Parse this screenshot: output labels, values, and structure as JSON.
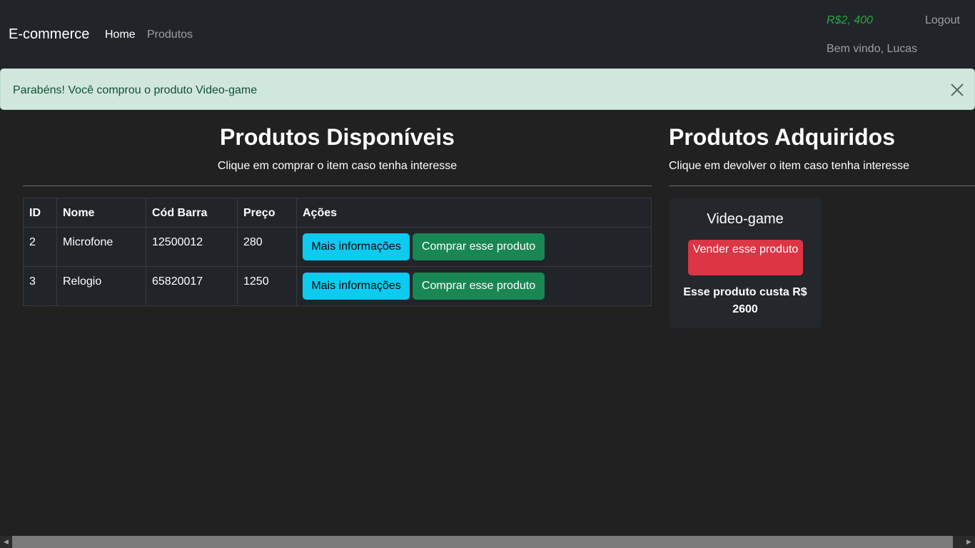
{
  "navbar": {
    "brand": "E-commerce",
    "links": [
      "Home",
      "Produtos"
    ],
    "balance": "R$2, 400",
    "logout": "Logout",
    "welcome": "Bem vindo, Lucas"
  },
  "alert": {
    "message": "Parabéns! Você comprou o produto Video-game",
    "close_icon": "close-icon"
  },
  "available": {
    "title": "Produtos Disponíveis",
    "subtitle": "Clique em comprar o item caso tenha interesse",
    "columns": [
      "ID",
      "Nome",
      "Cód Barra",
      "Preço",
      "Ações"
    ],
    "rows": [
      {
        "id": "2",
        "nome": "Microfone",
        "cod": "12500012",
        "preco": "280",
        "info_label": "Mais informações",
        "buy_label": "Comprar esse produto"
      },
      {
        "id": "3",
        "nome": "Relogio",
        "cod": "65820017",
        "preco": "1250",
        "info_label": "Mais informações",
        "buy_label": "Comprar esse produto"
      }
    ]
  },
  "acquired": {
    "title": "Produtos Adquiridos",
    "subtitle": "Clique em devolver o item caso tenha interesse",
    "items": [
      {
        "name": "Video-game",
        "sell_label": "Vender esse produto",
        "price_text": "Esse produto custa R$ 2600"
      }
    ]
  },
  "colors": {
    "page_bg": "#212121",
    "navbar_bg": "#212529",
    "balance": "#28a745",
    "alert_bg": "#d1e7dd",
    "alert_text": "#0f5132",
    "info_button": "#0dcaf0",
    "success_button": "#198754",
    "danger_button": "#dc3545"
  }
}
